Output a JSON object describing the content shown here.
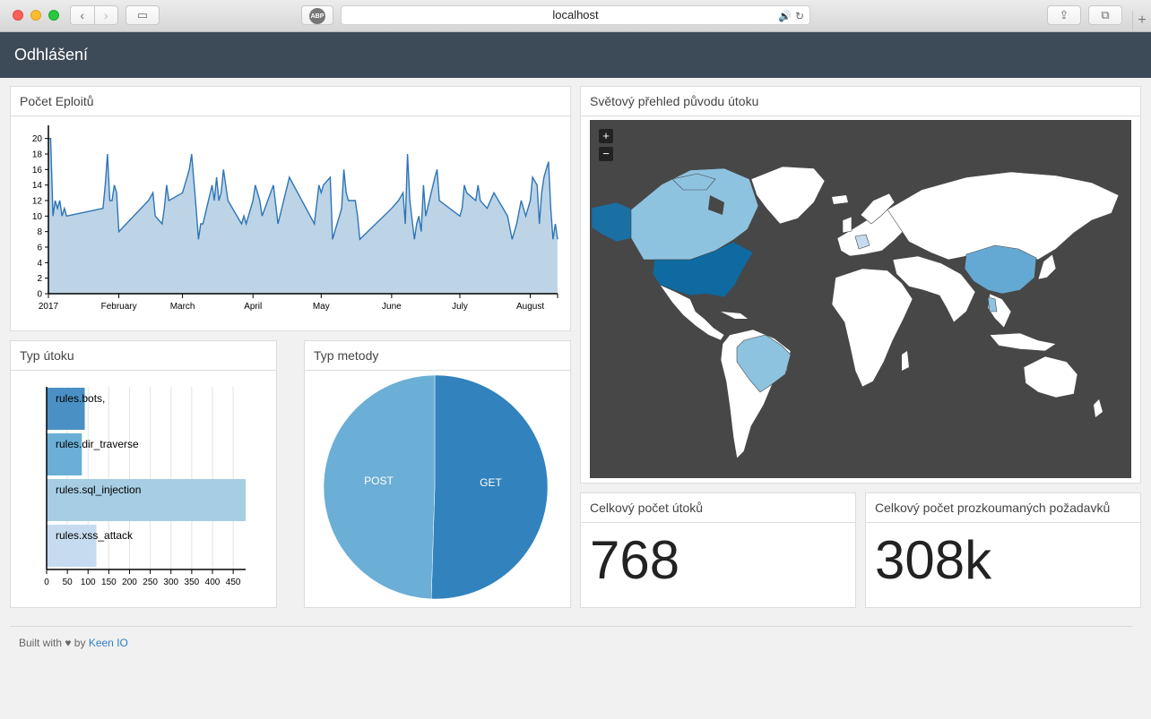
{
  "browser": {
    "url": "localhost",
    "abp_label": "ABP",
    "back_glyph": "‹",
    "forward_glyph": "›",
    "sidebar_glyph": "▭",
    "share_glyph": "⇪",
    "tabs_glyph": "⧉",
    "new_tab_glyph": "+"
  },
  "header": {
    "title": "Odhlášení"
  },
  "cards": {
    "exploits": {
      "title": "Počet Eploitů"
    },
    "attack_type": {
      "title": "Typ útoku"
    },
    "method_type": {
      "title": "Typ metody"
    },
    "world_map": {
      "title": "Světový přehled původu útoku",
      "zoom_in": "+",
      "zoom_out": "−"
    },
    "total_attacks": {
      "title": "Celkový počet útoků",
      "value": "768"
    },
    "total_requests": {
      "title": "Celkový počet prozkoumaných požadavků",
      "value": "308k"
    }
  },
  "footer": {
    "text": "Built with ♥ by",
    "link": "Keen IO"
  },
  "chart_data": [
    {
      "type": "area",
      "title": "Počet Eploitů",
      "x_tick_labels": [
        "2017",
        "February",
        "March",
        "April",
        "May",
        "June",
        "July",
        "August"
      ],
      "ylim": [
        0,
        21
      ],
      "y_ticks": [
        0,
        2,
        4,
        6,
        8,
        10,
        12,
        14,
        16,
        18,
        20
      ],
      "x": [
        "2017-01-01",
        "2017-01-02",
        "2017-01-03",
        "2017-01-04",
        "2017-01-05",
        "2017-01-06",
        "2017-01-07",
        "2017-01-08",
        "2017-01-09",
        "2017-01-25",
        "2017-01-26",
        "2017-01-27",
        "2017-01-28",
        "2017-01-29",
        "2017-01-30",
        "2017-01-31",
        "2017-02-01",
        "2017-02-14",
        "2017-02-16",
        "2017-02-17",
        "2017-02-20",
        "2017-02-21",
        "2017-02-22",
        "2017-02-23",
        "2017-03-01",
        "2017-03-04",
        "2017-03-05",
        "2017-03-07",
        "2017-03-08",
        "2017-03-09",
        "2017-03-10",
        "2017-03-14",
        "2017-03-15",
        "2017-03-16",
        "2017-03-17",
        "2017-03-18",
        "2017-03-19",
        "2017-03-20",
        "2017-03-21",
        "2017-03-27",
        "2017-03-28",
        "2017-03-29",
        "2017-04-01",
        "2017-04-02",
        "2017-04-04",
        "2017-04-05",
        "2017-04-10",
        "2017-04-12",
        "2017-04-17",
        "2017-04-28",
        "2017-04-30",
        "2017-05-01",
        "2017-05-02",
        "2017-05-05",
        "2017-05-06",
        "2017-05-07",
        "2017-05-10",
        "2017-05-11",
        "2017-05-12",
        "2017-05-13",
        "2017-05-14",
        "2017-05-16",
        "2017-05-17",
        "2017-05-18",
        "2017-06-01",
        "2017-06-04",
        "2017-06-06",
        "2017-06-07",
        "2017-06-08",
        "2017-06-09",
        "2017-06-11",
        "2017-06-12",
        "2017-06-13",
        "2017-06-14",
        "2017-06-15",
        "2017-06-16",
        "2017-06-20",
        "2017-06-21",
        "2017-06-22",
        "2017-07-01",
        "2017-07-02",
        "2017-07-03",
        "2017-07-04",
        "2017-07-08",
        "2017-07-09",
        "2017-07-10",
        "2017-07-13",
        "2017-07-16",
        "2017-07-22",
        "2017-07-24",
        "2017-07-26",
        "2017-07-28",
        "2017-07-30",
        "2017-08-01",
        "2017-08-02",
        "2017-08-04",
        "2017-08-05",
        "2017-08-06",
        "2017-08-07",
        "2017-08-08",
        "2017-08-09",
        "2017-08-10",
        "2017-08-11",
        "2017-08-12",
        "2017-08-13"
      ],
      "values": [
        20,
        20,
        10,
        12,
        11,
        12,
        10,
        11,
        10,
        11,
        14,
        18,
        12,
        12,
        14,
        13,
        8,
        12,
        13,
        10,
        9,
        11,
        14,
        12,
        13,
        16,
        18,
        11,
        7,
        9,
        9,
        14,
        12,
        15,
        12,
        13,
        16,
        14,
        12,
        9,
        10,
        9,
        12,
        14,
        12,
        10,
        14,
        9,
        15,
        9,
        14,
        13,
        14,
        15,
        7,
        8,
        11,
        16,
        13,
        12,
        12,
        12,
        10,
        7,
        11,
        12,
        13,
        9,
        18,
        12,
        7,
        9,
        10,
        8,
        14,
        10,
        15,
        16,
        12,
        10,
        11,
        14,
        13,
        12,
        14,
        12,
        11,
        13,
        10,
        7,
        9,
        12,
        10,
        12,
        15,
        14,
        9,
        13,
        15,
        16,
        17,
        11,
        7,
        9,
        7
      ],
      "color": "#2e75b6",
      "fill": "#bdd4e6"
    },
    {
      "type": "bar",
      "title": "Typ útoku",
      "categories": [
        "rules.bots,",
        "rules.dir_traverse",
        "rules.sql_injection",
        "rules.xss_attack"
      ],
      "values": [
        92,
        85,
        480,
        120
      ],
      "colors": [
        "#4a90c4",
        "#6baed6",
        "#a6cde3",
        "#c6dbef"
      ],
      "xlim": [
        0,
        480
      ],
      "x_ticks": [
        0,
        50,
        100,
        150,
        200,
        250,
        300,
        350,
        400,
        450
      ]
    },
    {
      "type": "pie",
      "title": "Typ metody",
      "categories": [
        "GET",
        "POST"
      ],
      "values": [
        50.5,
        49.5
      ],
      "colors": [
        "#3182bd",
        "#6baed6"
      ]
    }
  ]
}
